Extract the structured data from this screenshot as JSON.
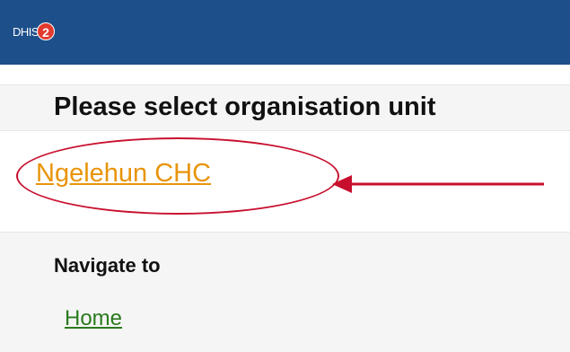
{
  "header": {
    "logo_text": "DHIS",
    "logo_badge": "2"
  },
  "main": {
    "select_title": "Please select organisation unit",
    "orgunit_link": "Ngelehun CHC"
  },
  "nav": {
    "heading": "Navigate to",
    "home_link": "Home"
  },
  "colors": {
    "header_bg": "#1d4f8a",
    "orgunit_link": "#e8940a",
    "home_link": "#2a7a1d",
    "annotation_red": "#c8102e"
  }
}
